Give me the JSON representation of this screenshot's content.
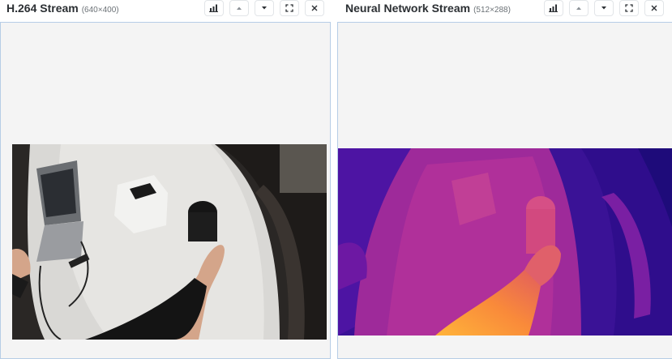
{
  "panels": [
    {
      "title": "H.264 Stream",
      "dims": "(640×400)",
      "buttons": [
        "bar-chart-icon",
        "chevron-up-icon",
        "chevron-down-icon",
        "fullscreen-icon",
        "close-icon"
      ]
    },
    {
      "title": "Neural Network Stream",
      "dims": "(512×288)",
      "buttons": [
        "bar-chart-icon",
        "chevron-up-icon",
        "chevron-down-icon",
        "fullscreen-icon",
        "close-icon"
      ]
    }
  ],
  "colors": {
    "panel_border": "#b6cde6",
    "panel_background": "#f4f4f4",
    "title_text": "#2b2f33"
  }
}
